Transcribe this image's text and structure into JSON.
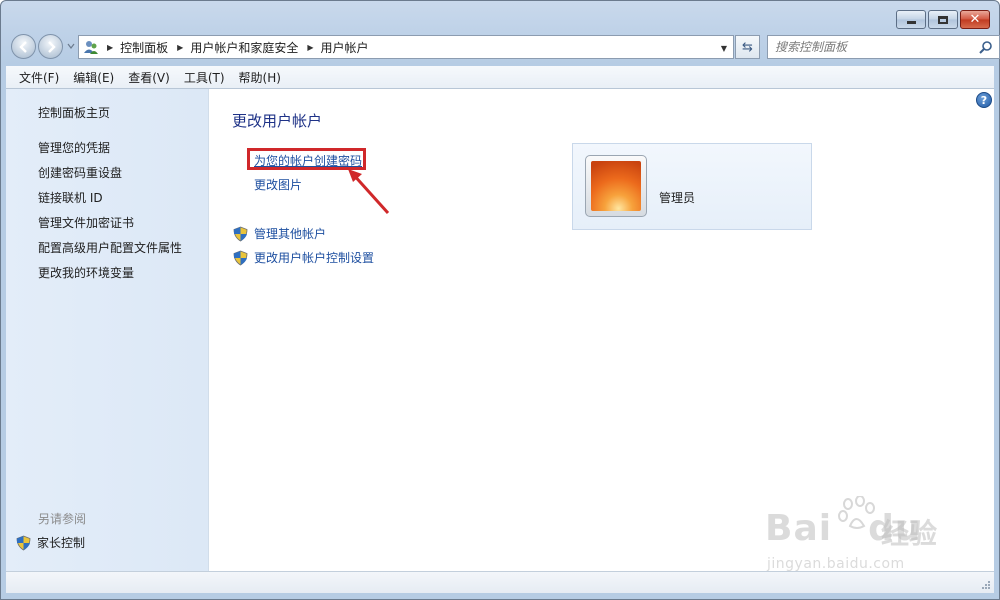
{
  "window": {
    "caption_buttons": [
      "minimize",
      "maximize",
      "close"
    ]
  },
  "navigation": {
    "breadcrumbs": [
      "控制面板",
      "用户帐户和家庭安全",
      "用户帐户"
    ],
    "search_placeholder": "搜索控制面板"
  },
  "menu": {
    "items": [
      "文件(F)",
      "编辑(E)",
      "查看(V)",
      "工具(T)",
      "帮助(H)"
    ]
  },
  "sidebar": {
    "home": "控制面板主页",
    "links": [
      "管理您的凭据",
      "创建密码重设盘",
      "链接联机 ID",
      "管理文件加密证书",
      "配置高级用户配置文件属性",
      "更改我的环境变量"
    ],
    "see_also_title": "另请参阅",
    "see_also_items": [
      "家长控制"
    ]
  },
  "main": {
    "title": "更改用户帐户",
    "tasks": [
      "为您的帐户创建密码",
      "更改图片"
    ],
    "admin_tasks": [
      "管理其他帐户",
      "更改用户帐户控制设置"
    ],
    "account": {
      "role": "管理员"
    },
    "annotation_color": "#d0282a"
  },
  "watermark": {
    "brand": "Bai",
    "brand2": "du",
    "cn": "经验",
    "url": "jingyan.baidu.com"
  }
}
